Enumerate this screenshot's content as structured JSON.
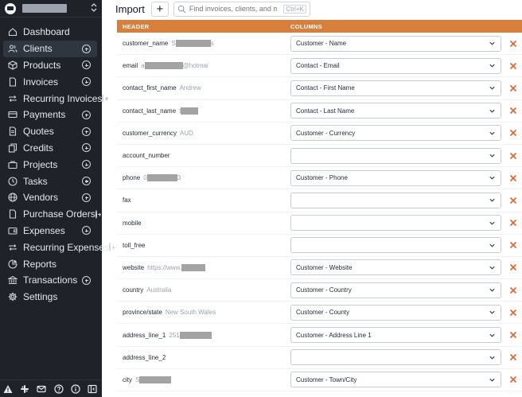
{
  "app": {
    "colors": {
      "sidebar_bg": "#1f2329",
      "accent_header": "#d97f3c",
      "remove_icon": "#e0642e"
    }
  },
  "topbar": {
    "title": "Import",
    "add_label": "+",
    "search_placeholder": "Find invoices, clients, and more",
    "search_shortcut": "Ctrl+K"
  },
  "sidebar": {
    "items": [
      {
        "label": "Dashboard",
        "icon": "home-icon",
        "plus": false,
        "active": false
      },
      {
        "label": "Clients",
        "icon": "users-icon",
        "plus": true,
        "active": true
      },
      {
        "label": "Products",
        "icon": "box-icon",
        "plus": true,
        "active": false
      },
      {
        "label": "Invoices",
        "icon": "file-icon",
        "plus": true,
        "active": false
      },
      {
        "label": "Recurring Invoices",
        "icon": "repeat-icon",
        "plus": true,
        "active": false
      },
      {
        "label": "Payments",
        "icon": "credit-card-icon",
        "plus": true,
        "active": false
      },
      {
        "label": "Quotes",
        "icon": "file-text-icon",
        "plus": true,
        "active": false
      },
      {
        "label": "Credits",
        "icon": "copy-icon",
        "plus": true,
        "active": false
      },
      {
        "label": "Projects",
        "icon": "briefcase-icon",
        "plus": true,
        "active": false
      },
      {
        "label": "Tasks",
        "icon": "clock-icon",
        "plus": true,
        "active": false
      },
      {
        "label": "Vendors",
        "icon": "globe-icon",
        "plus": true,
        "active": false
      },
      {
        "label": "Purchase Orders",
        "icon": "file-icon",
        "plus": true,
        "active": false
      },
      {
        "label": "Expenses",
        "icon": "wallet-icon",
        "plus": true,
        "active": false
      },
      {
        "label": "Recurring Expenses",
        "icon": "repeat-icon",
        "plus": true,
        "active": false
      },
      {
        "label": "Reports",
        "icon": "pie-chart-icon",
        "plus": false,
        "active": false
      },
      {
        "label": "Transactions",
        "icon": "bank-icon",
        "plus": true,
        "active": false
      },
      {
        "label": "Settings",
        "icon": "gear-icon",
        "plus": false,
        "active": false
      }
    ],
    "bottom_icons": [
      "warning-icon",
      "slack-icon",
      "mail-icon",
      "help-icon",
      "info-icon",
      "collapse-icon"
    ]
  },
  "table": {
    "header_label": "HEADER",
    "columns_label": "COLUMNS",
    "rows": [
      {
        "field": "customer_name",
        "sample_text": "S",
        "redacted": true,
        "redact_len": 44,
        "sample_suffix": "s",
        "mapping": "Customer - Name"
      },
      {
        "field": "email",
        "sample_text": "a",
        "redacted": true,
        "redact_len": 48,
        "sample_suffix": "@hotmai",
        "mapping": "Contact - Email"
      },
      {
        "field": "contact_first_name",
        "sample_text": "Andrew",
        "redacted": false,
        "mapping": "Contact - First Name"
      },
      {
        "field": "contact_last_name",
        "sample_text": "t",
        "redacted": true,
        "redact_len": 22,
        "sample_suffix": "",
        "mapping": "Contact - Last Name"
      },
      {
        "field": "customer_currency",
        "sample_text": "AUD",
        "redacted": false,
        "mapping": "Customer - Currency"
      },
      {
        "field": "account_number",
        "sample_text": "",
        "redacted": false,
        "mapping": ""
      },
      {
        "field": "phone",
        "sample_text": "0",
        "redacted": true,
        "redact_len": 38,
        "sample_suffix": "3",
        "mapping": "Customer - Phone"
      },
      {
        "field": "fax",
        "sample_text": "",
        "redacted": false,
        "mapping": ""
      },
      {
        "field": "mobile",
        "sample_text": "",
        "redacted": false,
        "mapping": ""
      },
      {
        "field": "toll_free",
        "sample_text": "",
        "redacted": false,
        "mapping": ""
      },
      {
        "field": "website",
        "sample_text": "https://www.",
        "redacted": true,
        "redact_len": 30,
        "sample_suffix": "",
        "mapping": "Customer - Website"
      },
      {
        "field": "country",
        "sample_text": "Australia",
        "redacted": false,
        "mapping": "Customer - Country"
      },
      {
        "field": "province/state",
        "sample_text": "New South Wales",
        "redacted": false,
        "mapping": "Customer - County"
      },
      {
        "field": "address_line_1",
        "sample_text": "251",
        "redacted": true,
        "redact_len": 40,
        "sample_suffix": "",
        "mapping": "Customer - Address Line 1"
      },
      {
        "field": "address_line_2",
        "sample_text": "",
        "redacted": false,
        "mapping": ""
      },
      {
        "field": "city",
        "sample_text": "S",
        "redacted": true,
        "redact_len": 40,
        "sample_suffix": "",
        "mapping": "Customer - Town/City"
      }
    ]
  }
}
